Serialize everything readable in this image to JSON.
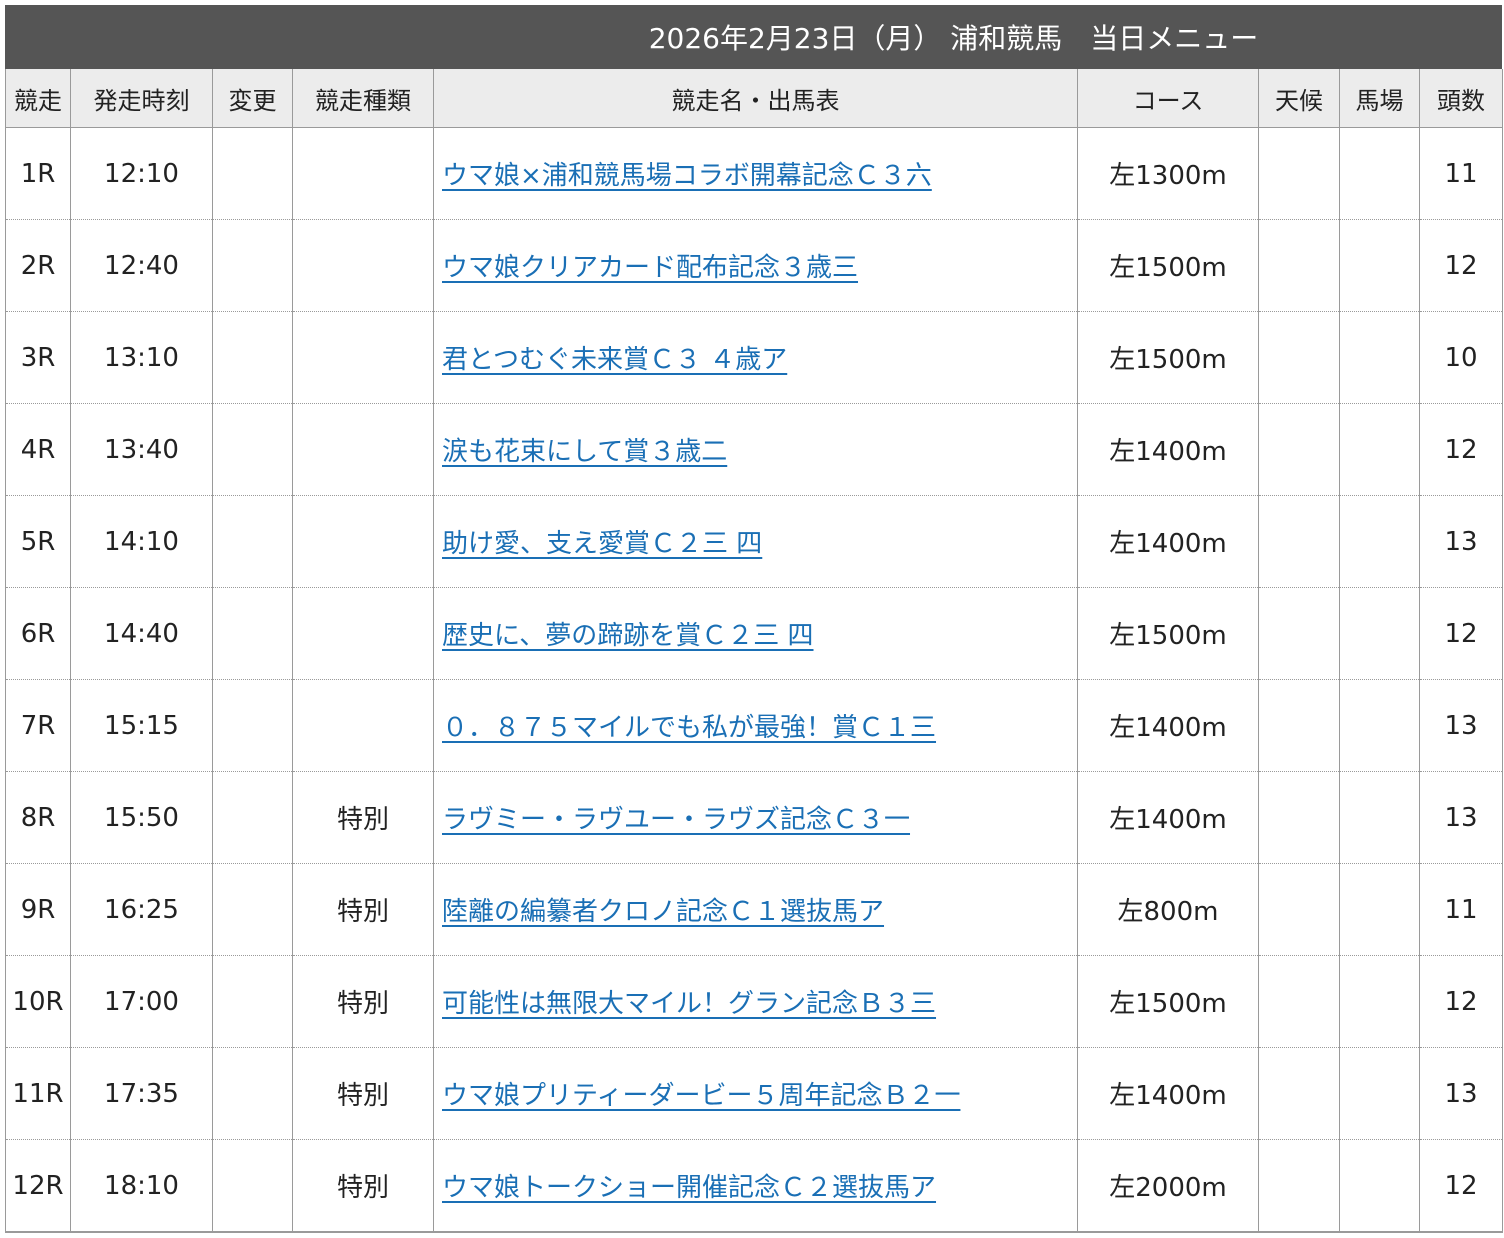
{
  "title": "2026年2月23日（月） 浦和競馬　当日メニュー",
  "headers": {
    "race": "競走",
    "time": "発走時刻",
    "change": "変更",
    "type": "競走種類",
    "name": "競走名・出馬表",
    "course": "コース",
    "weather": "天候",
    "track": "馬場",
    "count": "頭数"
  },
  "races": [
    {
      "race": "1R",
      "time": "12:10",
      "change": "",
      "type": "",
      "name": "ウマ娘×浦和競馬場コラボ開幕記念Ｃ３六",
      "course": "左1300m",
      "weather": "",
      "track": "",
      "count": "11"
    },
    {
      "race": "2R",
      "time": "12:40",
      "change": "",
      "type": "",
      "name": "ウマ娘クリアカード配布記念３歳三",
      "course": "左1500m",
      "weather": "",
      "track": "",
      "count": "12"
    },
    {
      "race": "3R",
      "time": "13:10",
      "change": "",
      "type": "",
      "name": "君とつむぐ未来賞Ｃ３ ４歳ア",
      "course": "左1500m",
      "weather": "",
      "track": "",
      "count": "10"
    },
    {
      "race": "4R",
      "time": "13:40",
      "change": "",
      "type": "",
      "name": "涙も花束にして賞３歳二",
      "course": "左1400m",
      "weather": "",
      "track": "",
      "count": "12"
    },
    {
      "race": "5R",
      "time": "14:10",
      "change": "",
      "type": "",
      "name": "助け愛、支え愛賞Ｃ２三 四",
      "course": "左1400m",
      "weather": "",
      "track": "",
      "count": "13"
    },
    {
      "race": "6R",
      "time": "14:40",
      "change": "",
      "type": "",
      "name": "歴史に、夢の蹄跡を賞Ｃ２三 四",
      "course": "左1500m",
      "weather": "",
      "track": "",
      "count": "12"
    },
    {
      "race": "7R",
      "time": "15:15",
      "change": "",
      "type": "",
      "name": "０．８７５マイルでも私が最強！賞Ｃ１三",
      "course": "左1400m",
      "weather": "",
      "track": "",
      "count": "13"
    },
    {
      "race": "8R",
      "time": "15:50",
      "change": "",
      "type": "特別",
      "name": "ラヴミー・ラヴユー・ラヴズ記念Ｃ３一",
      "course": "左1400m",
      "weather": "",
      "track": "",
      "count": "13"
    },
    {
      "race": "9R",
      "time": "16:25",
      "change": "",
      "type": "特別",
      "name": "陸離の編纂者クロノ記念Ｃ１選抜馬ア",
      "course": "左800m",
      "weather": "",
      "track": "",
      "count": "11"
    },
    {
      "race": "10R",
      "time": "17:00",
      "change": "",
      "type": "特別",
      "name": "可能性は無限大マイル！グラン記念Ｂ３三",
      "course": "左1500m",
      "weather": "",
      "track": "",
      "count": "12"
    },
    {
      "race": "11R",
      "time": "17:35",
      "change": "",
      "type": "特別",
      "name": "ウマ娘プリティーダービー５周年記念Ｂ２一",
      "course": "左1400m",
      "weather": "",
      "track": "",
      "count": "13"
    },
    {
      "race": "12R",
      "time": "18:10",
      "change": "",
      "type": "特別",
      "name": "ウマ娘トークショー開催記念Ｃ２選抜馬ア",
      "course": "左2000m",
      "weather": "",
      "track": "",
      "count": "12"
    }
  ]
}
